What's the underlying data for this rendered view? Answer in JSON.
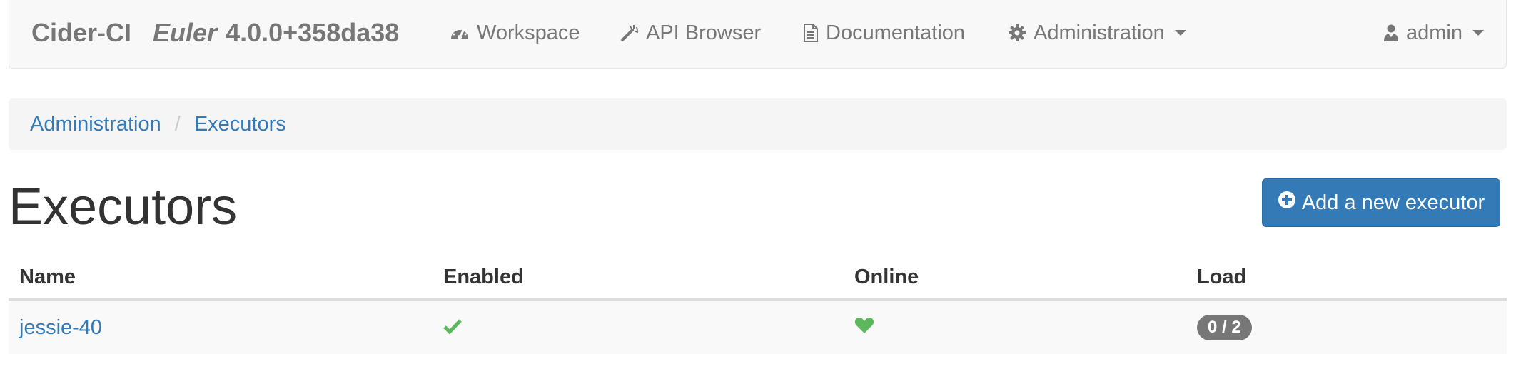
{
  "navbar": {
    "brand": "Cider-CI",
    "codename": "Euler",
    "version": "4.0.0+358da38",
    "items": [
      {
        "label": "Workspace",
        "icon": "dashboard-icon"
      },
      {
        "label": "API Browser",
        "icon": "magic-wand-icon"
      },
      {
        "label": "Documentation",
        "icon": "file-icon"
      },
      {
        "label": "Administration",
        "icon": "gear-icon"
      }
    ],
    "user": {
      "label": "admin",
      "icon": "user-icon"
    }
  },
  "breadcrumb": {
    "items": [
      "Administration",
      "Executors"
    ],
    "separator": "/"
  },
  "page": {
    "title": "Executors",
    "add_button_label": "Add a new executor"
  },
  "table": {
    "headers": [
      "Name",
      "Enabled",
      "Online",
      "Load"
    ],
    "rows": [
      {
        "name": "jessie-40",
        "enabled": true,
        "online": true,
        "load": "0 / 2"
      }
    ]
  },
  "colors": {
    "primary": "#337ab7",
    "success": "#5cb85c",
    "muted": "#777777"
  }
}
